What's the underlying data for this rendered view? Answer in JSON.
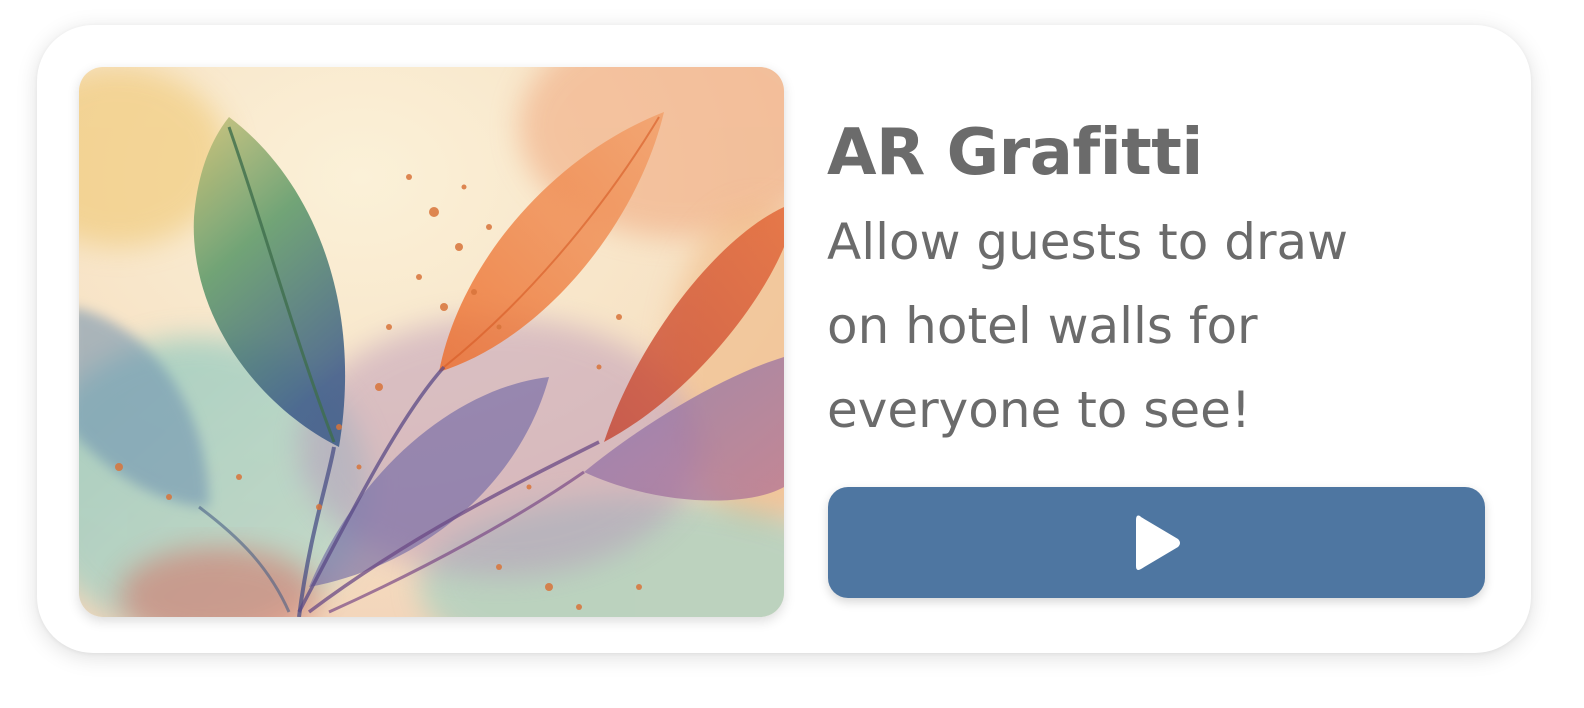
{
  "card": {
    "title": "AR Grafitti",
    "description_lines": [
      "Allow guests to draw",
      "on hotel walls for",
      "everyone to see!"
    ],
    "image": {
      "subject": "watercolor leaves illustration"
    },
    "play_button": {
      "icon": "play-icon",
      "color": "#4e76a1"
    }
  },
  "colors": {
    "text": "#6b6b6b",
    "accent": "#4e76a1",
    "card_background": "#ffffff"
  }
}
